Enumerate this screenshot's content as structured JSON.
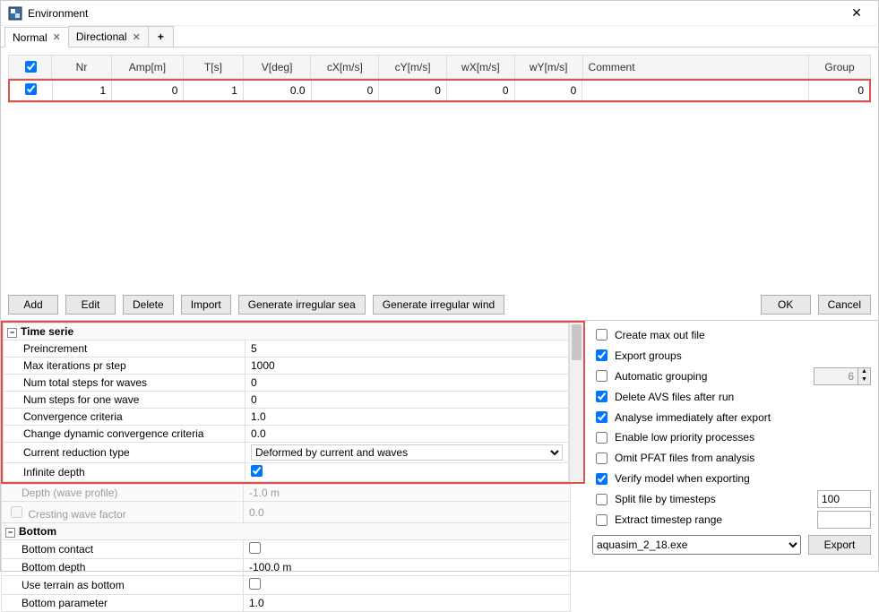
{
  "window": {
    "title": "Environment"
  },
  "tabs": {
    "normal": "Normal",
    "directional": "Directional",
    "plus": "+"
  },
  "grid": {
    "headers": {
      "nr": "Nr",
      "amp": "Amp[m]",
      "t": "T[s]",
      "v": "V[deg]",
      "cx": "cX[m/s]",
      "cy": "cY[m/s]",
      "wx": "wX[m/s]",
      "wy": "wY[m/s]",
      "comment": "Comment",
      "group": "Group"
    },
    "row": {
      "nr": "1",
      "amp": "0",
      "t": "1",
      "v": "0.0",
      "cx": "0",
      "cy": "0",
      "wx": "0",
      "wy": "0",
      "comment": "",
      "group": "0"
    }
  },
  "buttons": {
    "add": "Add",
    "edit": "Edit",
    "delete": "Delete",
    "import": "Import",
    "genSea": "Generate irregular sea",
    "genWind": "Generate irregular wind",
    "ok": "OK",
    "cancel": "Cancel",
    "export": "Export"
  },
  "props": {
    "section_time": "Time serie",
    "preincrement": {
      "l": "Preincrement",
      "v": "5"
    },
    "maxiter": {
      "l": "Max iterations pr step",
      "v": "1000"
    },
    "numtotal": {
      "l": "Num total steps for waves",
      "v": "0"
    },
    "numone": {
      "l": "Num steps for one wave",
      "v": "0"
    },
    "conv": {
      "l": "Convergence criteria",
      "v": "1.0"
    },
    "chgdyn": {
      "l": "Change dynamic convergence criteria",
      "v": "0.0"
    },
    "curred": {
      "l": "Current reduction type",
      "v": "Deformed by current and waves"
    },
    "infdepth": {
      "l": "Infinite depth"
    },
    "depthwp": {
      "l": "Depth (wave profile)",
      "v": "-1.0 m"
    },
    "cresting": {
      "l": "Cresting wave factor",
      "v": "0.0"
    },
    "section_bottom": "Bottom",
    "bcontact": {
      "l": "Bottom contact"
    },
    "bdepth": {
      "l": "Bottom depth",
      "v": "-100.0 m"
    },
    "useterrain": {
      "l": "Use terrain as bottom"
    },
    "bparam": {
      "l": "Bottom parameter",
      "v": "1.0"
    }
  },
  "opts": {
    "createmax": "Create max out file",
    "exportgroups": "Export groups",
    "autogroup": "Automatic grouping",
    "autogroup_val": "6",
    "delavs": "Delete AVS files after run",
    "analyse": "Analyse immediately after export",
    "lowprio": "Enable low priority processes",
    "omitpfat": "Omit PFAT files from analysis",
    "verify": "Verify model when exporting",
    "splitfile": "Split file by timesteps",
    "split_val": "100",
    "extractts": "Extract timestep range",
    "exe": "aquasim_2_18.exe"
  }
}
